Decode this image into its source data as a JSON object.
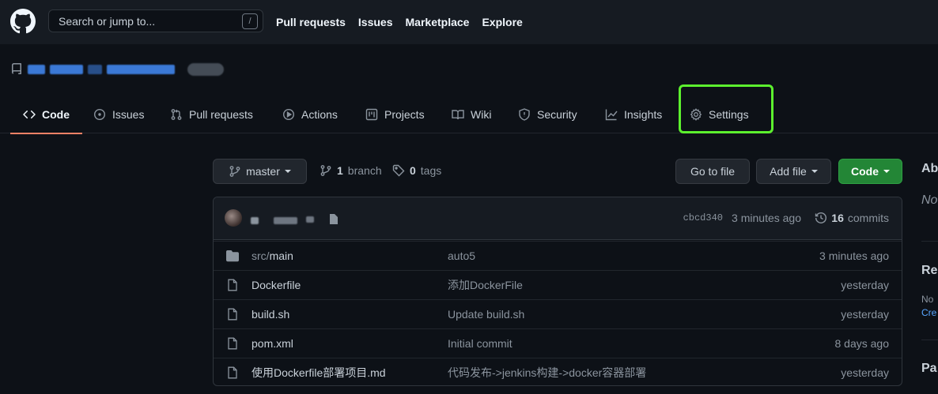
{
  "header": {
    "search_placeholder": "Search or jump to...",
    "search_shortcut": "/",
    "nav": [
      "Pull requests",
      "Issues",
      "Marketplace",
      "Explore"
    ]
  },
  "repo_tabs": [
    {
      "label": "Code",
      "icon": "code-icon",
      "selected": true
    },
    {
      "label": "Issues",
      "icon": "issue-opened-icon"
    },
    {
      "label": "Pull requests",
      "icon": "git-pull-request-icon"
    },
    {
      "label": "Actions",
      "icon": "play-icon"
    },
    {
      "label": "Projects",
      "icon": "project-icon"
    },
    {
      "label": "Wiki",
      "icon": "book-icon"
    },
    {
      "label": "Security",
      "icon": "shield-icon"
    },
    {
      "label": "Insights",
      "icon": "graph-icon"
    },
    {
      "label": "Settings",
      "icon": "gear-icon",
      "highlighted": true
    }
  ],
  "file_nav": {
    "branch": "master",
    "branch_count": "1",
    "branch_label": "branch",
    "tag_count": "0",
    "tag_label": "tags",
    "go_to_file": "Go to file",
    "add_file": "Add file",
    "code": "Code"
  },
  "latest_commit": {
    "sha": "cbcd340",
    "time": "3 minutes ago",
    "count": "16",
    "count_label": "commits"
  },
  "files": [
    {
      "type": "folder",
      "name_prefix": "src/",
      "name": "main",
      "message": "auto5",
      "age": "3 minutes ago"
    },
    {
      "type": "file",
      "name_prefix": "",
      "name": "Dockerfile",
      "message": "添加DockerFile",
      "age": "yesterday"
    },
    {
      "type": "file",
      "name_prefix": "",
      "name": "build.sh",
      "message": "Update build.sh",
      "age": "yesterday"
    },
    {
      "type": "file",
      "name_prefix": "",
      "name": "pom.xml",
      "message": "Initial commit",
      "age": "8 days ago"
    },
    {
      "type": "file",
      "name_prefix": "",
      "name": "使用Dockerfile部署项目.md",
      "message": "代码发布->jenkins构建->docker容器部署",
      "age": "yesterday"
    }
  ],
  "sidebar": {
    "about_heading": "Ab",
    "about_text": "No",
    "releases_heading": "Re",
    "releases_text": "No",
    "create_link": "Cre",
    "packages_heading": "Pa"
  },
  "colors": {
    "accent_underline": "#f78166",
    "highlight_box": "#5cf02e",
    "code_button": "#238636",
    "link": "#58a6ff"
  }
}
